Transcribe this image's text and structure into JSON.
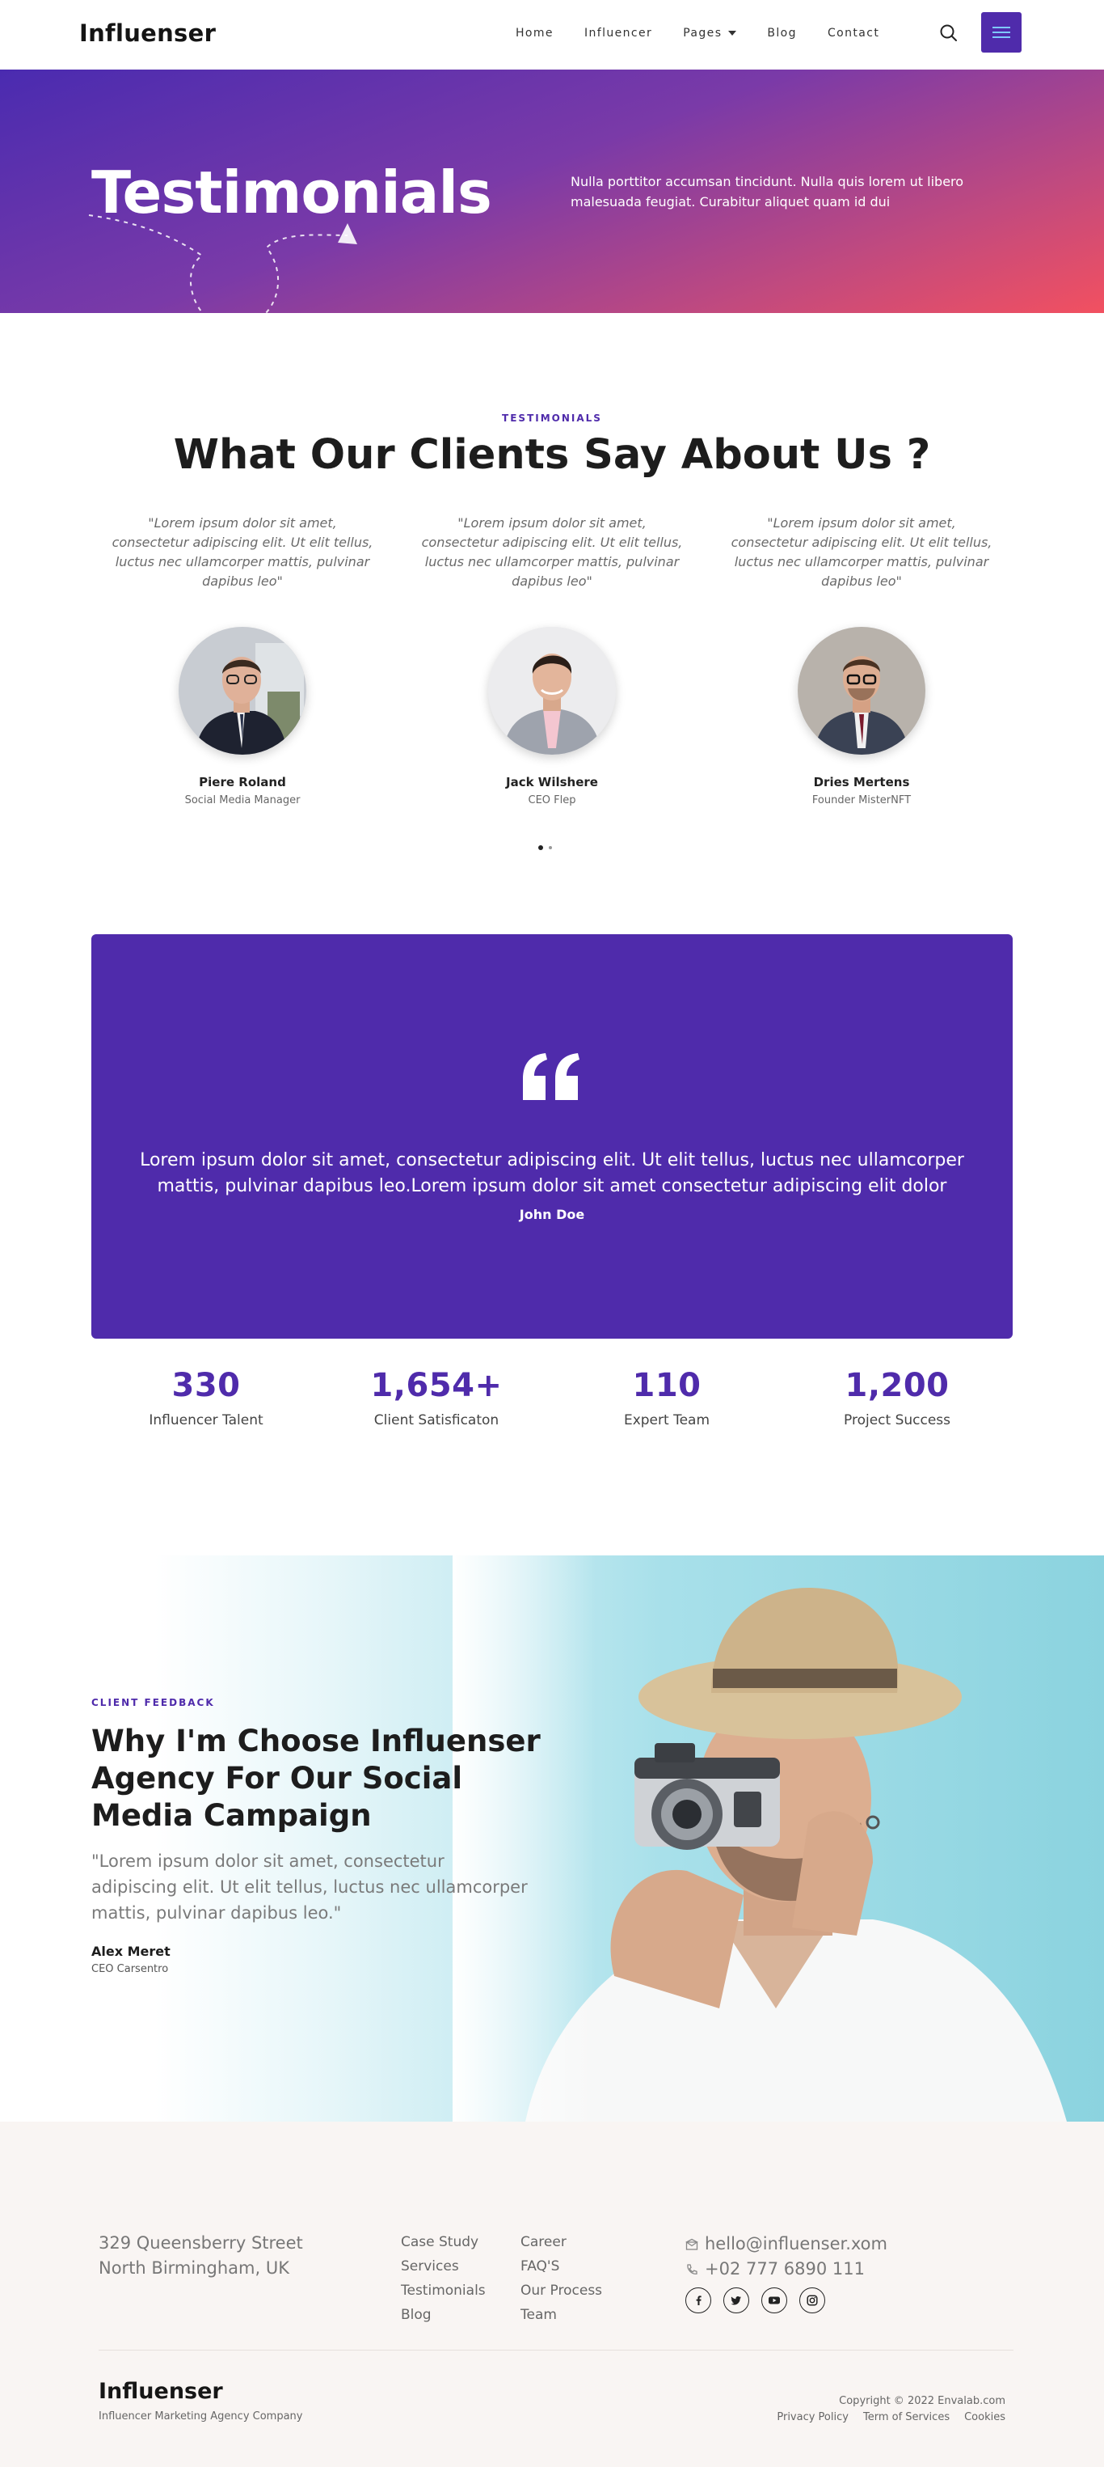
{
  "header": {
    "logo": "Influenser",
    "nav": [
      {
        "label": "Home"
      },
      {
        "label": "Influencer"
      },
      {
        "label": "Pages"
      },
      {
        "label": "Blog"
      },
      {
        "label": "Contact"
      }
    ],
    "icons": {
      "search": "search-icon",
      "menu": "hamburger-menu-icon"
    },
    "accent_color": "#4f2bab"
  },
  "hero": {
    "title": "Testimonials",
    "text": "Nulla porttitor accumsan tincidunt. Nulla quis lorem ut libero malesuada feugiat. Curabitur aliquet quam id dui"
  },
  "testimonials": {
    "eyebrow": "TESTIMONIALS",
    "heading": "What Our Clients Say About Us ?",
    "items": [
      {
        "quote": "\"Lorem ipsum dolor sit amet, consectetur adipiscing elit. Ut elit tellus, luctus nec ullamcorper mattis, pulvinar dapibus leo\"",
        "name": "Piere Roland",
        "role": "Social Media Manager"
      },
      {
        "quote": "\"Lorem ipsum dolor sit amet, consectetur adipiscing elit. Ut elit tellus, luctus nec ullamcorper mattis, pulvinar dapibus leo\"",
        "name": "Jack Wilshere",
        "role": "CEO Flep"
      },
      {
        "quote": "\"Lorem ipsum dolor sit amet, consectetur adipiscing elit. Ut elit tellus, luctus nec ullamcorper mattis, pulvinar dapibus leo\"",
        "name": "Dries Mertens",
        "role": "Founder MisterNFT"
      }
    ]
  },
  "featured_quote": {
    "text": "Lorem ipsum dolor sit amet, consectetur adipiscing elit. Ut elit tellus, luctus nec ullamcorper mattis, pulvinar dapibus leo.Lorem ipsum dolor sit amet consectetur adipiscing elit dolor",
    "author": "John Doe"
  },
  "stats": [
    {
      "value": "330",
      "label": "Influencer Talent"
    },
    {
      "value": "1,654+",
      "label": "Client Satisficaton"
    },
    {
      "value": "110",
      "label": "Expert Team"
    },
    {
      "value": "1,200",
      "label": "Project Success"
    }
  ],
  "feedback": {
    "eyebrow": "CLIENT FEEDBACK",
    "heading": "Why I'm Choose Influenser Agency For Our Social Media Campaign",
    "quote": "\"Lorem ipsum dolor sit amet, consectetur adipiscing elit. Ut elit tellus, luctus nec ullamcorper mattis, pulvinar dapibus leo.\"",
    "name": "Alex Meret",
    "role": "CEO Carsentro"
  },
  "footer": {
    "address_line1": "329 Queensberry Street",
    "address_line2": "North Birmingham, UK",
    "links_col1": [
      "Case Study",
      "Services",
      "Testimonials",
      "Blog"
    ],
    "links_col2": [
      "Career",
      "FAQ'S",
      "Our Process",
      "Team"
    ],
    "email": "hello@influenser.xom",
    "phone": "+02 777 6890 111",
    "socials": [
      "facebook-icon",
      "twitter-icon",
      "youtube-icon",
      "instagram-icon"
    ],
    "logo": "Influenser",
    "tagline": "Influencer Marketing Agency Company",
    "copyright": "Copyright © 2022 Envalab.com",
    "legal": [
      "Privacy Policy",
      "Term of Services",
      "Cookies"
    ]
  }
}
